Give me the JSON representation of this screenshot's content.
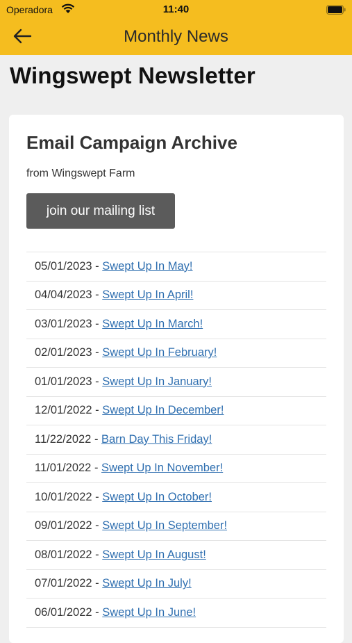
{
  "status_bar": {
    "carrier": "Operadora",
    "time": "11:40"
  },
  "app_bar": {
    "title": "Monthly News",
    "icons": {
      "back": "arrow-left-icon"
    }
  },
  "page": {
    "title": "Wingswept Newsletter"
  },
  "card": {
    "title": "Email Campaign Archive",
    "subtitle": "from Wingswept Farm",
    "join_button": "join our mailing list",
    "separator": " - ",
    "campaigns": [
      {
        "date": "05/01/2023",
        "title": "Swept Up In May!"
      },
      {
        "date": "04/04/2023",
        "title": "Swept Up In April!"
      },
      {
        "date": "03/01/2023",
        "title": "Swept Up In March!"
      },
      {
        "date": "02/01/2023",
        "title": "Swept Up In February!"
      },
      {
        "date": "01/01/2023",
        "title": "Swept Up In January!"
      },
      {
        "date": "12/01/2022",
        "title": "Swept Up In December!"
      },
      {
        "date": "11/22/2022",
        "title": "Barn Day This Friday!"
      },
      {
        "date": "11/01/2022",
        "title": "Swept Up In November!"
      },
      {
        "date": "10/01/2022",
        "title": "Swept Up In October!"
      },
      {
        "date": "09/01/2022",
        "title": "Swept Up In September!"
      },
      {
        "date": "08/01/2022",
        "title": "Swept Up In August!"
      },
      {
        "date": "07/01/2022",
        "title": "Swept Up In July!"
      },
      {
        "date": "06/01/2022",
        "title": "Swept Up In June!"
      }
    ]
  },
  "colors": {
    "app_bar": "#f5bd1f",
    "link": "#2f6fb0",
    "button": "#5b5b5b",
    "background": "#efefef"
  }
}
